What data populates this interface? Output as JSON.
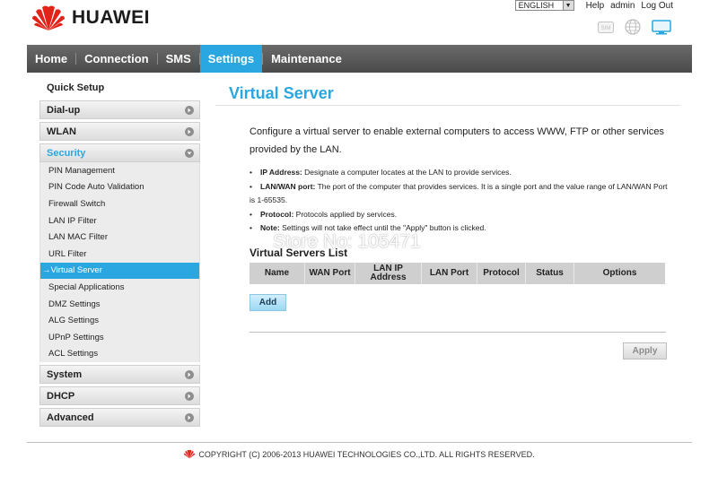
{
  "header": {
    "brand": "HUAWEI",
    "language": "ENGLISH",
    "links": [
      "Help",
      "admin",
      "Log Out"
    ],
    "icons": [
      "sim-icon",
      "globe-icon",
      "monitor-icon"
    ],
    "sim_label": "SIM"
  },
  "nav": {
    "items": [
      {
        "label": "Home",
        "active": false
      },
      {
        "label": "Connection",
        "active": false
      },
      {
        "label": "SMS",
        "active": false
      },
      {
        "label": "Settings",
        "active": true
      },
      {
        "label": "Maintenance",
        "active": false
      }
    ]
  },
  "sidebar": {
    "quick_setup": "Quick Setup",
    "sections": [
      {
        "label": "Dial-up"
      },
      {
        "label": "WLAN"
      },
      {
        "label": "Security"
      },
      {
        "label": "System"
      },
      {
        "label": "DHCP"
      },
      {
        "label": "Advanced"
      }
    ],
    "security_items": [
      "PIN Management",
      "PIN Code Auto Validation",
      "Firewall Switch",
      "LAN IP Filter",
      "LAN MAC Filter",
      "URL Filter",
      "→Virtual Server",
      "Special Applications",
      "DMZ Settings",
      "ALG Settings",
      "UPnP Settings",
      "ACL Settings"
    ]
  },
  "main": {
    "title": "Virtual Server",
    "intro": "Configure a virtual server to enable external computers to access WWW, FTP or other services provided by the LAN.",
    "bullets": [
      {
        "term": "IP Address:",
        "text": " Designate a computer locates at the LAN to provide services."
      },
      {
        "term": "LAN/WAN port:",
        "text": " The port of the computer that provides services. It is a single port and the value range of LAN/WAN Port is 1-65535."
      },
      {
        "term": "Protocol:",
        "text": " Protocols applied by services."
      },
      {
        "term": "Note:",
        "text": " Settings will not take effect until the \"Apply\" button is clicked."
      }
    ],
    "watermark": "Store No: 105471",
    "list_title": "Virtual Servers List",
    "columns": [
      "Name",
      "WAN Port",
      "LAN IP Address",
      "LAN Port",
      "Protocol",
      "Status",
      "Options"
    ],
    "add_label": "Add",
    "apply_label": "Apply"
  },
  "footer": {
    "copyright": "COPYRIGHT (C) 2006-2013 HUAWEI TECHNOLOGIES CO.,LTD. ALL RIGHTS RESERVED."
  },
  "colors": {
    "accent": "#2aa7e0",
    "nav_bg": "#555555",
    "brand_red": "#e2231a"
  }
}
